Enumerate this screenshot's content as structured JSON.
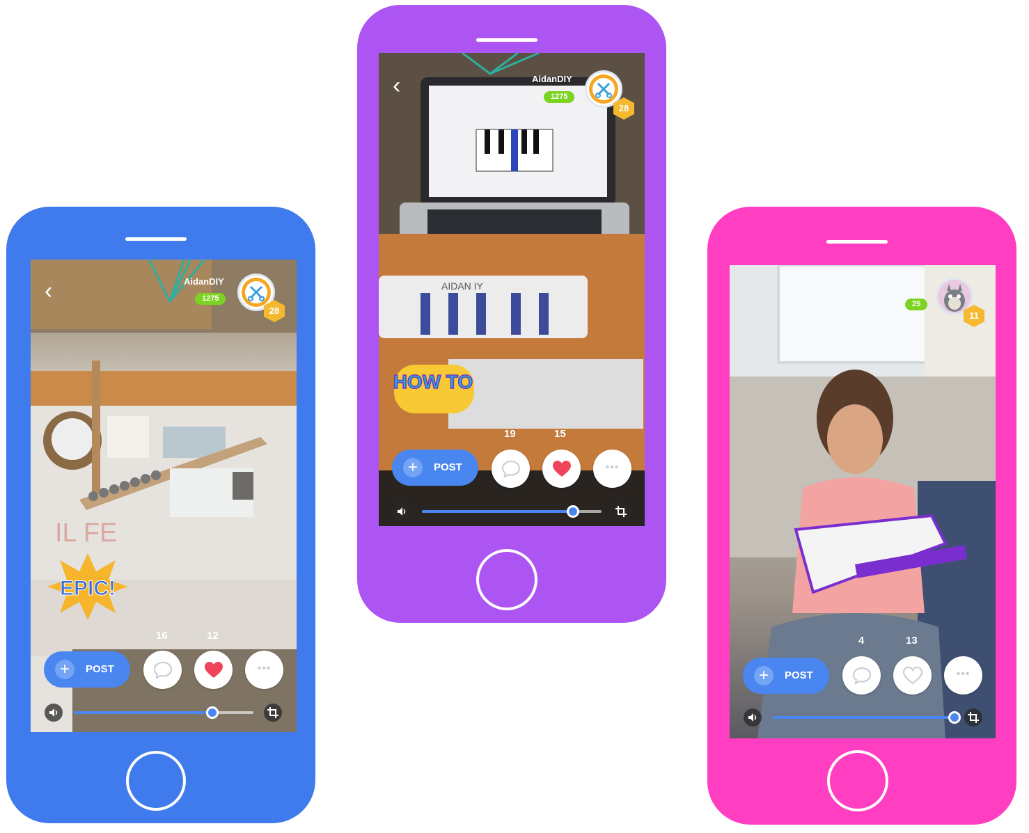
{
  "phones": [
    {
      "id": "blue",
      "frame_color": "#407bed",
      "username": "AidanDIY",
      "points": "1275",
      "level": "28",
      "sticker": "EPIC!",
      "comment_count": "16",
      "like_count": "12",
      "post_label": "POST",
      "liked": true,
      "progress": 0.77
    },
    {
      "id": "purple",
      "frame_color": "#ad55f3",
      "username": "AidanDIY",
      "points": "1275",
      "level": "28",
      "sticker": "HOW TO",
      "comment_count": "19",
      "like_count": "15",
      "post_label": "POST",
      "liked": true,
      "progress": 0.84,
      "board_label": "AIDAN  IY"
    },
    {
      "id": "pink",
      "frame_color": "#ff3ec2",
      "username": "",
      "points": "25",
      "level": "11",
      "comment_count": "4",
      "like_count": "13",
      "post_label": "POST",
      "liked": false,
      "progress": 0.99
    }
  ],
  "colors": {
    "accent_blue": "#4a86f0",
    "points_green": "#7dd321",
    "level_gold": "#f5b82e",
    "heart_red": "#f0445a"
  },
  "icons": [
    "back-chevron-icon",
    "comment-bubble-icon",
    "heart-icon",
    "more-dots-icon",
    "volume-icon",
    "crop-icon",
    "plus-icon"
  ]
}
